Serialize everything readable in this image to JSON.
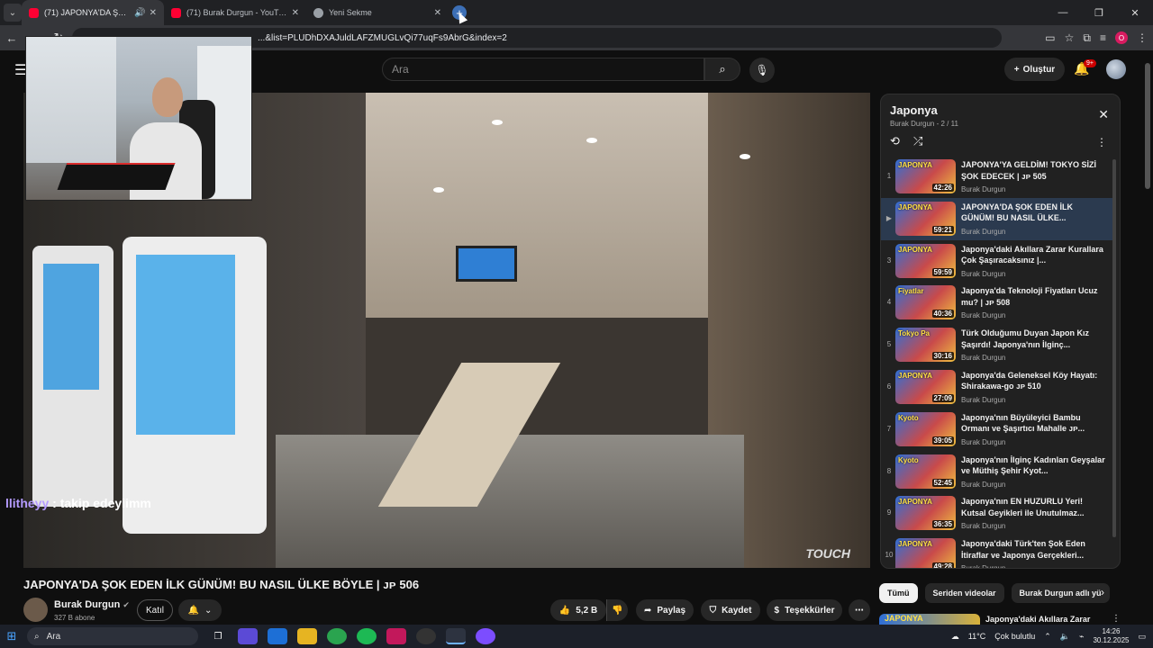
{
  "browser": {
    "tabs": [
      {
        "title": "(71) JAPONYA'DA ŞOK EDEN",
        "favicon": "youtube-icon",
        "active": true
      },
      {
        "title": "(71) Burak Durgun - YouTube",
        "favicon": "youtube-icon",
        "active": false
      },
      {
        "title": "Yeni Sekme",
        "favicon": "chrome-icon",
        "active": false
      }
    ],
    "url": "...&list=PLUDhDXAJuldLAFZMUGLvQi77uqFs9AbrG&index=2",
    "profile_initial": "O"
  },
  "youtube": {
    "search_placeholder": "Ara",
    "create_label": "Oluştur",
    "notification_badge": "9+"
  },
  "stream": {
    "chat_user": "llitheyy",
    "chat_message": ": takip edeyiimm",
    "watermark": "TOUCH"
  },
  "video": {
    "title": "JAPONYA'DA ŞOK EDEN İLK GÜNÜM! BU NASIL ÜLKE BÖYLE | ᴊᴘ 506",
    "channel": "Burak Durgun",
    "subscribers": "327 B abone",
    "join_label": "Katıl",
    "likes": "5,2 B",
    "share_label": "Paylaş",
    "save_label": "Kaydet",
    "thanks_label": "Teşekkürler"
  },
  "playlist": {
    "title": "Japonya",
    "channel": "Burak Durgun",
    "position": "2 / 11",
    "items": [
      {
        "index": "1",
        "title": "JAPONYA'YA GELDİM! TOKYO SİZİ ŞOK EDECEK | ᴊᴘ 505",
        "channel": "Burak Durgun",
        "duration": "42:26",
        "thumb_text": "JAPONYA",
        "active": false
      },
      {
        "index": "▶",
        "title": "JAPONYA'DA ŞOK EDEN İLK GÜNÜM! BU NASIL ÜLKE...",
        "channel": "Burak Durgun",
        "duration": "59:21",
        "thumb_text": "JAPONYA",
        "active": true
      },
      {
        "index": "3",
        "title": "Japonya'daki Akıllara Zarar Kurallara Çok Şaşıracaksınız |...",
        "channel": "Burak Durgun",
        "duration": "59:59",
        "thumb_text": "JAPONYA",
        "active": false
      },
      {
        "index": "4",
        "title": "Japonya'da Teknoloji Fiyatları Ucuz mu? | ᴊᴘ 508",
        "channel": "Burak Durgun",
        "duration": "40:36",
        "thumb_text": "Fiyatlar",
        "active": false
      },
      {
        "index": "5",
        "title": "Türk Olduğumu Duyan Japon Kız Şaşırdı! Japonya'nın İlginç...",
        "channel": "Burak Durgun",
        "duration": "30:16",
        "thumb_text": "Tokyo Pa",
        "active": false
      },
      {
        "index": "6",
        "title": "Japonya'da Geleneksel Köy Hayatı: Shirakawa-go ᴊᴘ 510",
        "channel": "Burak Durgun",
        "duration": "27:09",
        "thumb_text": "JAPONYA",
        "active": false
      },
      {
        "index": "7",
        "title": "Japonya'nın Büyüleyici Bambu Ormanı ve Şaşırtıcı Mahalle ᴊᴘ...",
        "channel": "Burak Durgun",
        "duration": "39:05",
        "thumb_text": "Kyoto",
        "active": false
      },
      {
        "index": "8",
        "title": "Japonya'nın İlginç Kadınları Geyşalar ve Müthiş Şehir Kyot...",
        "channel": "Burak Durgun",
        "duration": "52:45",
        "thumb_text": "Kyoto",
        "active": false
      },
      {
        "index": "9",
        "title": "Japonya'nın EN HUZURLU Yeri! Kutsal Geyikleri ile Unutulmaz...",
        "channel": "Burak Durgun",
        "duration": "36:35",
        "thumb_text": "JAPONYA",
        "active": false
      },
      {
        "index": "10",
        "title": "Japonya'daki Türk'ten Şok Eden İtiraflar ve Japonya Gerçekleri...",
        "channel": "Burak Durgun",
        "duration": "49:28",
        "thumb_text": "JAPONYA",
        "active": false
      }
    ]
  },
  "chips": [
    "Tümü",
    "Seriden videolar",
    "Burak Durgun adlı yü"
  ],
  "recommendation": {
    "thumb_text": "JAPONYA",
    "title": "Japonya'daki Akıllara Zarar"
  },
  "taskbar": {
    "search_label": "Ara",
    "temperature": "11°C",
    "weather": "Çok bulutlu",
    "time": "14:26",
    "date": "30.12.2025"
  },
  "colors": {
    "youtube_red": "#ff0033",
    "active_row": "#2b3a4f",
    "chat_user": "#b59cff"
  }
}
